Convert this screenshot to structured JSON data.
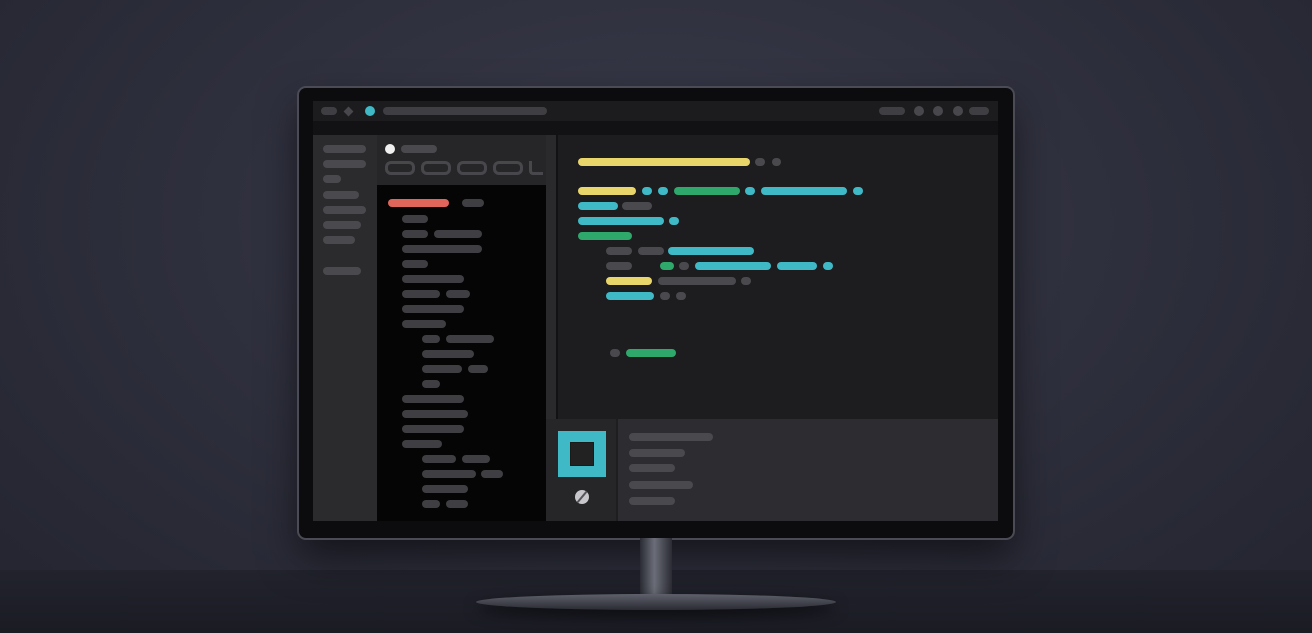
{
  "scene": {
    "description_visible_text": ""
  },
  "window": {
    "title": "",
    "accent_color": "#3fb9c6"
  },
  "palette": {
    "keyword": "#e9d66b",
    "identifier": "#3fb9c6",
    "string": "#2ea86b",
    "error": "#e0655a",
    "placeholder": "#4a4a4e"
  },
  "icons": {
    "run_state": "stop-square-icon",
    "settings": "settings-icon",
    "window_controls": [
      "close-dot-icon",
      "diamond-icon",
      "accent-dot-icon"
    ]
  }
}
